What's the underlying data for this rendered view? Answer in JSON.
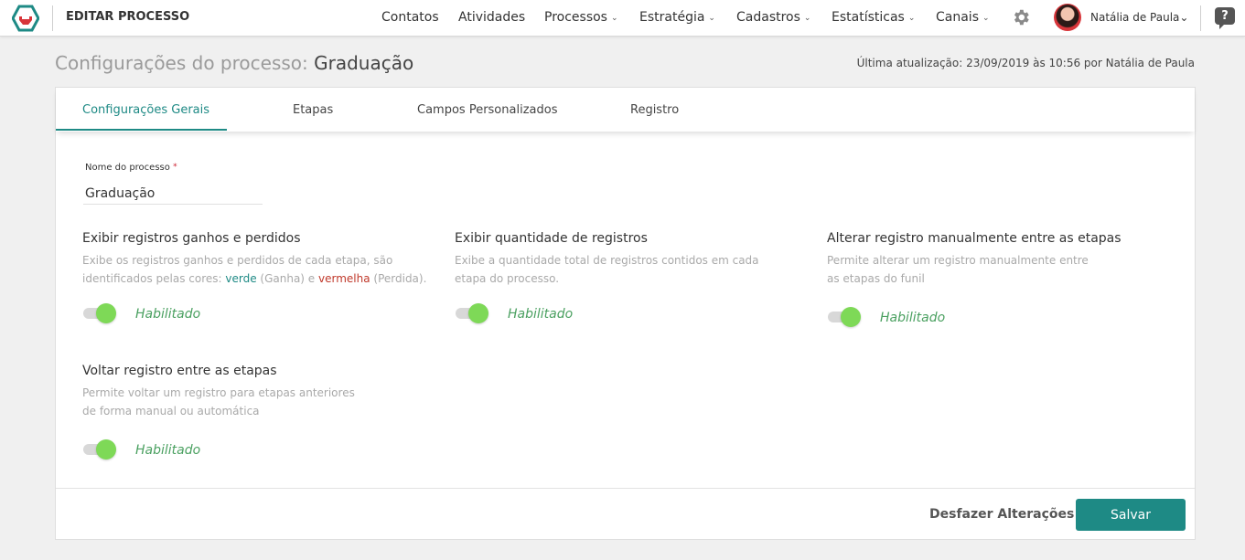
{
  "app": {
    "title": "EDITAR PROCESSO"
  },
  "nav": {
    "items": [
      {
        "label": "Contatos",
        "dropdown": false
      },
      {
        "label": "Atividades",
        "dropdown": false
      },
      {
        "label": "Processos",
        "dropdown": true
      },
      {
        "label": "Estratégia",
        "dropdown": true
      },
      {
        "label": "Cadastros",
        "dropdown": true
      },
      {
        "label": "Estatísticas",
        "dropdown": true
      },
      {
        "label": "Canais",
        "dropdown": true
      }
    ],
    "caret": "⌄",
    "user_name": "Natália de Paula",
    "help_label": "?"
  },
  "header": {
    "prefix": "Configurações do processo:",
    "process_name": "Graduação",
    "last_update": "Última atualização: 23/09/2019 às 10:56 por Natália de Paula"
  },
  "tabs": [
    {
      "label": "Configurações Gerais",
      "active": true
    },
    {
      "label": "Etapas",
      "active": false
    },
    {
      "label": "Campos Personalizados",
      "active": false
    },
    {
      "label": "Registro",
      "active": false
    }
  ],
  "form": {
    "name_label": "Nome do processo",
    "required_mark": "*",
    "name_value": "Graduação"
  },
  "options": [
    {
      "title": "Exibir registros ganhos e perdidos",
      "desc_part1": "Exibe os registros ganhos e perdidos de cada etapa, são identificados pelas cores: ",
      "desc_green": "verde",
      "desc_part2": " (Ganha) e ",
      "desc_red": "vermelha",
      "desc_part3": " (Perdida).",
      "enabled": true,
      "status": "Habilitado"
    },
    {
      "title": "Exibir quantidade de registros",
      "desc": "Exibe a quantidade total de registros contidos em cada etapa do processo.",
      "enabled": true,
      "status": "Habilitado"
    },
    {
      "title": "Alterar registro manualmente entre as etapas",
      "desc_line1": "Permite alterar um registro manualmente entre",
      "desc_line2": "as etapas do funil",
      "enabled": true,
      "status": "Habilitado"
    },
    {
      "title": "Voltar registro entre as etapas",
      "desc_line1": "Permite voltar um registro para etapas anteriores",
      "desc_line2": "de forma manual ou automática",
      "enabled": true,
      "status": "Habilitado"
    }
  ],
  "actions": {
    "undo_label": "Desfazer Alterações",
    "save_label": "Salvar"
  },
  "colors": {
    "accent": "#1e8a85",
    "toggle_on": "#7ed957",
    "status_text": "#4aa060",
    "loss_red": "#c0392b"
  }
}
